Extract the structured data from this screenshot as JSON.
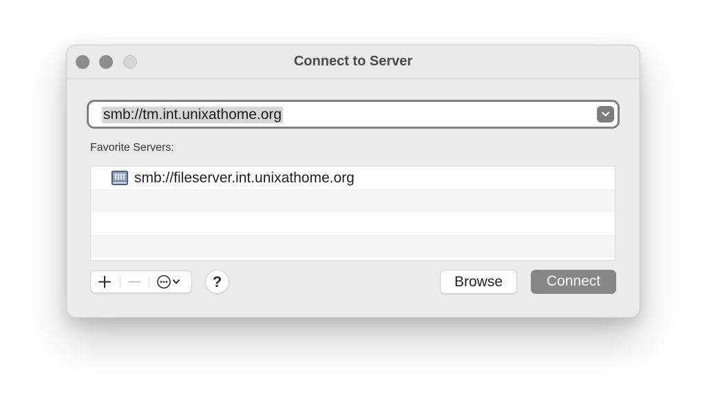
{
  "window": {
    "title": "Connect to Server"
  },
  "address": {
    "value": "smb://tm.int.unixathome.org"
  },
  "favorites": {
    "label": "Favorite Servers:",
    "items": [
      {
        "name": "smb://fileserver.int.unixathome.org",
        "icon": "network-server-icon"
      }
    ]
  },
  "toolbar": {
    "add_icon": "plus-icon",
    "remove_icon": "minus-icon",
    "action_icon": "ellipsis-circle-icon",
    "help_label": "?",
    "browse_label": "Browse",
    "connect_label": "Connect"
  },
  "colors": {
    "connect_button": "#868686",
    "window_bg": "#ecebea",
    "traffic_light": "#8e8d8d"
  }
}
